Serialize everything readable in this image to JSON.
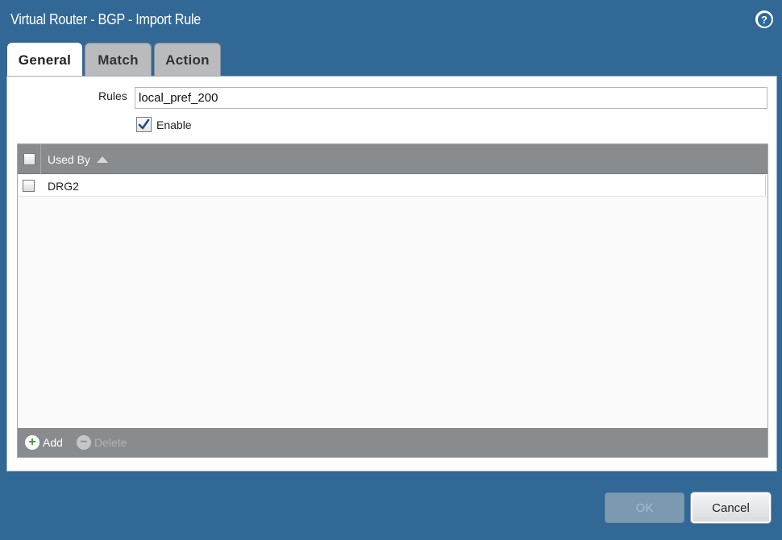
{
  "dialog": {
    "title": "Virtual Router - BGP - Import Rule",
    "help_icon": "question-circle-icon"
  },
  "tabs": [
    {
      "label": "General",
      "active": true
    },
    {
      "label": "Match",
      "active": false
    },
    {
      "label": "Action",
      "active": false
    }
  ],
  "general": {
    "rules_label": "Rules",
    "rules_value": "local_pref_200",
    "enable_label": "Enable",
    "enable_checked": true
  },
  "used_by": {
    "header": "Used By",
    "sort": "ascending",
    "rows": [
      {
        "name": "DRG2",
        "checked": false
      }
    ],
    "add_label": "Add",
    "delete_label": "Delete"
  },
  "buttons": {
    "ok_label": "OK",
    "cancel_label": "Cancel"
  },
  "colors": {
    "frame": "#326896",
    "grid_header": "#898c8f",
    "add_icon": "#3a9a2c"
  }
}
